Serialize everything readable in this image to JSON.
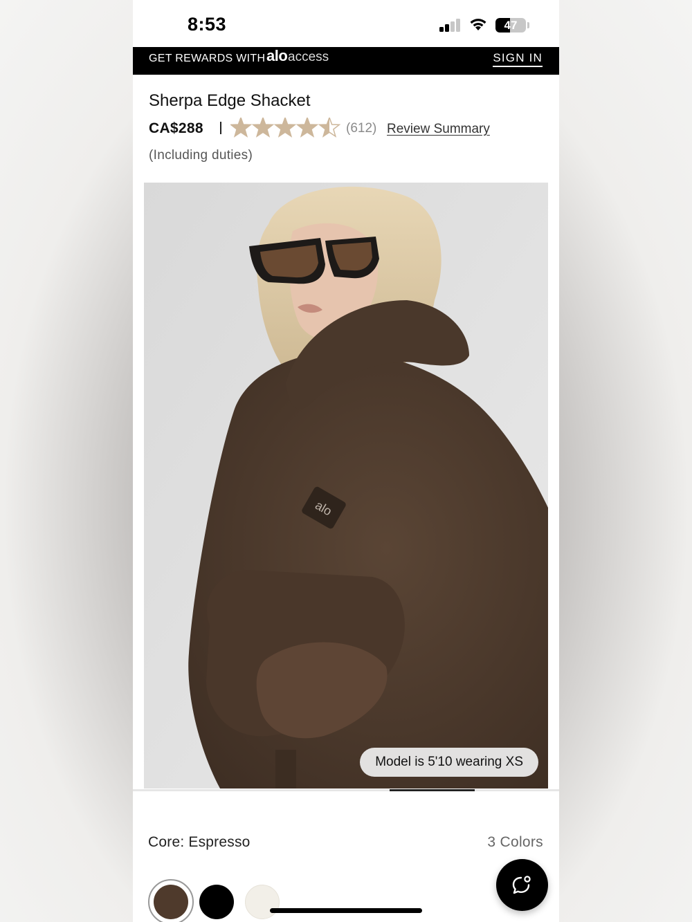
{
  "status_bar": {
    "time": "8:53",
    "battery_level": "47",
    "icons": [
      "cellular-signal-icon",
      "wifi-icon",
      "battery-icon"
    ]
  },
  "rewards_banner": {
    "text": "GET REWARDS WITH",
    "brand": "alo",
    "program": "access",
    "sign_in_label": "SIGN IN"
  },
  "product": {
    "title": "Sherpa Edge Shacket",
    "price": "CA$288",
    "rating": 4.5,
    "rating_max": 5,
    "review_count": "(612)",
    "review_summary_label": "Review Summary",
    "duties_note": "(Including duties)",
    "star_color": "#cdb79b",
    "image": {
      "model_note": "Model is 5'10 wearing XS"
    }
  },
  "colors": {
    "selected_name": "Core: Espresso",
    "count_label": "3 Colors",
    "swatches": [
      {
        "name": "Espresso",
        "hex": "#4f3a2c",
        "selected": true
      },
      {
        "name": "Black",
        "hex": "#000000",
        "selected": false
      },
      {
        "name": "Ivory",
        "hex": "#f2efe8",
        "selected": false
      }
    ]
  },
  "chat": {
    "icon": "chat-bubble-icon"
  }
}
